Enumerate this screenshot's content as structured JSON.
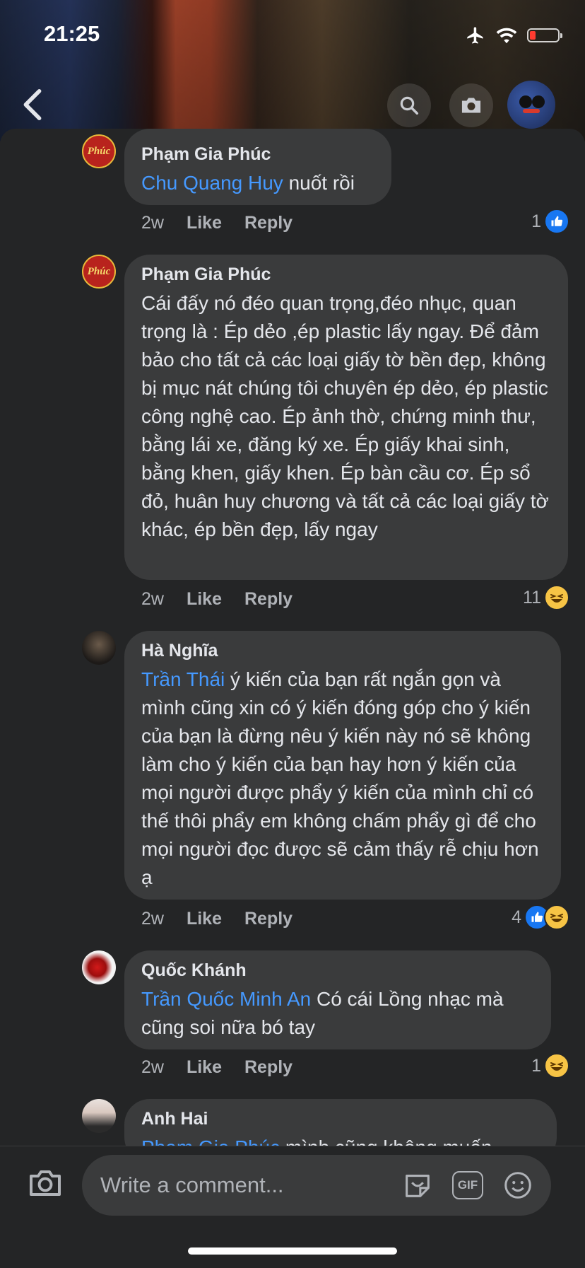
{
  "status_bar": {
    "time": "21:25"
  },
  "top_bar": {
    "back_icon": "chevron-left-icon",
    "search_icon": "search-icon",
    "camera_icon": "camera-icon"
  },
  "comments": [
    {
      "author": "Phạm Gia Phúc",
      "avatar_text": "Phúc",
      "mention": "Chu Quang Huy",
      "text": " nuốt rồi",
      "time": "2w",
      "like": "Like",
      "reply": "Reply",
      "reaction_count": "1",
      "reactions": [
        "like"
      ]
    },
    {
      "author": "Phạm Gia Phúc",
      "avatar_text": "Phúc",
      "mention": "",
      "text": "Cái đấy nó đéo quan trọng,đéo nhục, quan trọng là : Ép dẻo ,ép plastic lấy ngay. Để đảm bảo cho tất cả các loại giấy tờ bền đẹp, không bị mục nát chúng tôi chuyên ép dẻo, ép plastic công nghệ cao. Ép ảnh thờ, chứng minh thư, bằng lái xe, đăng ký xe. Ép giấy khai sinh, bằng khen, giấy khen. Ép bàn cầu cơ. Ép sổ đỏ, huân huy chương và tất cả các loại giấy tờ khác, ép bền đẹp, lấy ngay",
      "time": "2w",
      "like": "Like",
      "reply": "Reply",
      "reaction_count": "11",
      "reactions": [
        "haha"
      ]
    },
    {
      "author": "Hà Nghĩa",
      "mention": "Trần Thái",
      "text": " ý kiến của bạn rất ngắn gọn và mình cũng xin có ý kiến đóng góp cho ý kiến của bạn là đừng nêu ý kiến này nó sẽ không làm cho ý kiến của bạn hay hơn ý kiến của mọi người được phẩy ý kiến của mình chỉ có thế thôi phẩy em không chấm phẩy gì để cho mọi người đọc được sẽ cảm thấy rễ chịu hơn ạ",
      "time": "2w",
      "like": "Like",
      "reply": "Reply",
      "reaction_count": "4",
      "reactions": [
        "like",
        "haha"
      ]
    },
    {
      "author": "Quốc Khánh",
      "mention": "Trần Quốc Minh An",
      "text": " Có cái Lồng nhạc mà cũng soi nữa bó tay",
      "time": "2w",
      "like": "Like",
      "reply": "Reply",
      "reaction_count": "1",
      "reactions": [
        "haha"
      ]
    },
    {
      "author": "Anh Hai",
      "mention": "Phạm Gia Phúc",
      "text": " mình cũng không muốn"
    }
  ],
  "composer": {
    "placeholder": "Write a comment...",
    "icons": [
      "camera-icon",
      "sticker-icon",
      "gif-icon",
      "emoji-icon"
    ],
    "gif_label": "GIF"
  },
  "colors": {
    "background": "#242526",
    "bubble": "#3a3b3c",
    "mention": "#4599ff",
    "text": "#e4e6eb",
    "muted": "#b0b3b8",
    "like": "#1877f2"
  }
}
